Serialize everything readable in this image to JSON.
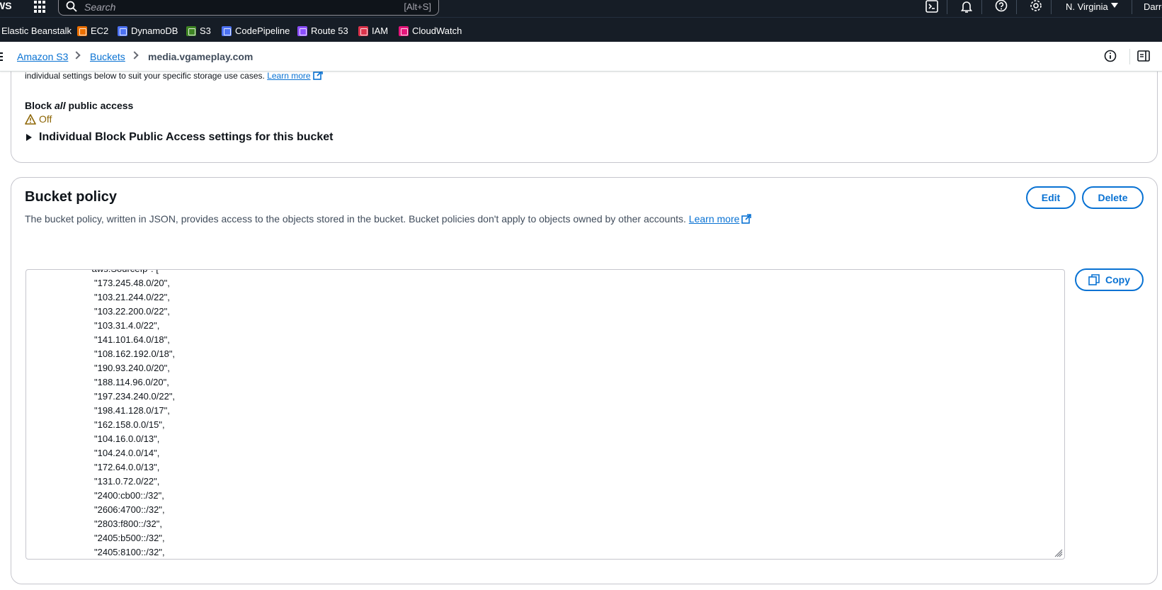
{
  "topnav": {
    "logo": "WS",
    "search_placeholder": "Search",
    "search_shortcut": "[Alt+S]",
    "region": "N. Virginia",
    "user": "Darren"
  },
  "servicebar": {
    "items": [
      {
        "label": "Elastic Beanstalk",
        "color": ""
      },
      {
        "label": "EC2",
        "color": "#ed7100"
      },
      {
        "label": "DynamoDB",
        "color": "#4d72f3"
      },
      {
        "label": "S3",
        "color": "#3f8624"
      },
      {
        "label": "CodePipeline",
        "color": "#4d72f3"
      },
      {
        "label": "Route 53",
        "color": "#8c4fff"
      },
      {
        "label": "IAM",
        "color": "#dd344c"
      },
      {
        "label": "CloudWatch",
        "color": "#e7157b"
      }
    ]
  },
  "breadcrumb": {
    "items": [
      "Amazon S3",
      "Buckets"
    ],
    "current": "media.vgameplay.com"
  },
  "block_public_access": {
    "description": "individual settings below to suit your specific storage use cases.",
    "learn_more": "Learn more",
    "label_prefix": "Block",
    "label_emphasis": "all",
    "label_suffix": "public access",
    "status": "Off",
    "expand_label": "Individual Block Public Access settings for this bucket"
  },
  "bucket_policy": {
    "title": "Bucket policy",
    "description": "The bucket policy, written in JSON, provides access to the objects stored in the bucket. Bucket policies don't apply to objects owned by other accounts.",
    "learn_more": "Learn more",
    "edit_label": "Edit",
    "delete_label": "Delete",
    "copy_label": "Copy",
    "code_lines": [
      "\"aws:SourceIp\": [",
      "  \"173.245.48.0/20\",",
      "  \"103.21.244.0/22\",",
      "  \"103.22.200.0/22\",",
      "  \"103.31.4.0/22\",",
      "  \"141.101.64.0/18\",",
      "  \"108.162.192.0/18\",",
      "  \"190.93.240.0/20\",",
      "  \"188.114.96.0/20\",",
      "  \"197.234.240.0/22\",",
      "  \"198.41.128.0/17\",",
      "  \"162.158.0.0/15\",",
      "  \"104.16.0.0/13\",",
      "  \"104.24.0.0/14\",",
      "  \"172.64.0.0/13\",",
      "  \"131.0.72.0/22\",",
      "  \"2400:cb00::/32\",",
      "  \"2606:4700::/32\",",
      "  \"2803:f800::/32\",",
      "  \"2405:b500::/32\",",
      "  \"2405:8100::/32\","
    ]
  }
}
